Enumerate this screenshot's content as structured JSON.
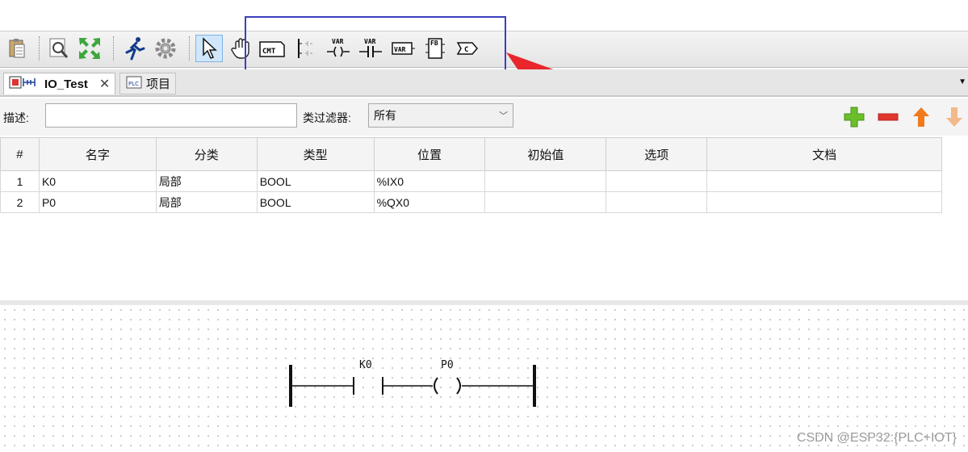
{
  "toolbar": {
    "tools": [
      {
        "icon": "paste-icon"
      },
      {
        "icon": "zoom-icon"
      },
      {
        "icon": "fit-screen-icon"
      },
      {
        "icon": "run-icon"
      },
      {
        "icon": "settings-gear-icon"
      },
      {
        "icon": "select-pointer-icon",
        "active": true
      },
      {
        "icon": "pan-hand-icon"
      },
      {
        "icon": "comment-icon",
        "label": "CMT"
      },
      {
        "icon": "power-rail-icon"
      },
      {
        "icon": "coil-icon",
        "label": "VAR"
      },
      {
        "icon": "contact-icon",
        "label": "VAR"
      },
      {
        "icon": "variable-icon",
        "label": "VAR"
      },
      {
        "icon": "function-block-icon",
        "label": "FB"
      },
      {
        "icon": "connection-icon",
        "label": "C"
      }
    ]
  },
  "tabs": [
    {
      "label": "IO_Test",
      "active": true,
      "icon": "ladder-program-icon"
    },
    {
      "label": "项目",
      "active": false,
      "icon": "plc-project-icon"
    }
  ],
  "filter": {
    "description_label": "描述:",
    "description_value": "",
    "class_filter_label": "类过滤器:",
    "class_filter_value": "所有",
    "actions": [
      "add-icon",
      "remove-icon",
      "move-up-icon",
      "move-down-icon"
    ]
  },
  "table": {
    "headers": [
      "#",
      "名字",
      "分类",
      "类型",
      "位置",
      "初始值",
      "选项",
      "文档"
    ],
    "rows": [
      [
        "1",
        "K0",
        "局部",
        "BOOL",
        "%IX0",
        "",
        "",
        ""
      ],
      [
        "2",
        "P0",
        "局部",
        "BOOL",
        "%QX0",
        "",
        "",
        ""
      ]
    ]
  },
  "ladder": {
    "contact_label": "K0",
    "coil_label": "P0"
  },
  "watermark": "CSDN @ESP32:{PLC+IOT}",
  "colors": {
    "highlight_box": "#3b3fbf",
    "arrow": "#e8262b",
    "add": "#6bbf2a",
    "remove": "#e0362c",
    "up": "#f07a1c",
    "down": "#f2b98a"
  }
}
